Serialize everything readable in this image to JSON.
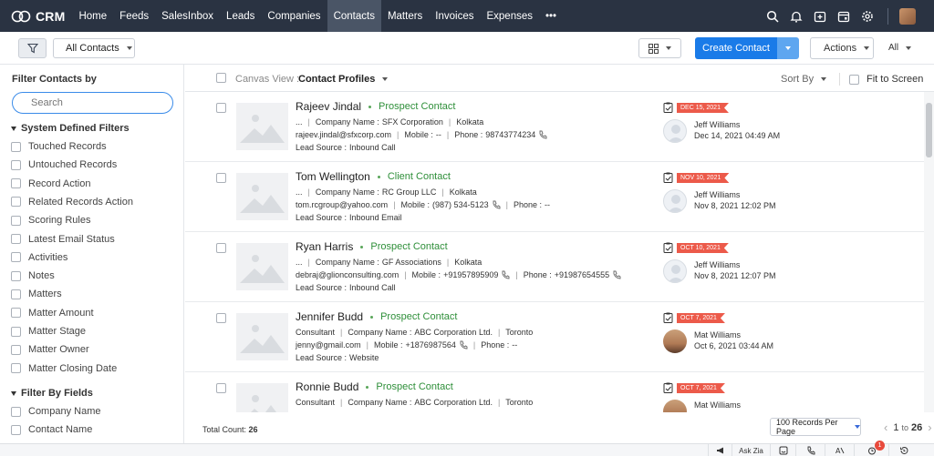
{
  "nav": {
    "brand": "CRM",
    "items": [
      "Home",
      "Feeds",
      "SalesInbox",
      "Leads",
      "Companies",
      "Contacts",
      "Matters",
      "Invoices",
      "Expenses",
      "•••"
    ],
    "active_index": 5,
    "icons": [
      "search-icon",
      "bell-icon",
      "calendar-add-icon",
      "calendar-icon",
      "gear-icon"
    ]
  },
  "toolbar": {
    "view_label": "All Contacts",
    "create_label": "Create Contact",
    "actions_label": "Actions",
    "all_label": "All"
  },
  "sidebar": {
    "title": "Filter Contacts by",
    "search_placeholder": "Search",
    "section1": "System Defined Filters",
    "system_filters": [
      "Touched Records",
      "Untouched Records",
      "Record Action",
      "Related Records Action",
      "Scoring Rules",
      "Latest Email Status",
      "Activities",
      "Notes",
      "Matters",
      "Matter Amount",
      "Matter Stage",
      "Matter Owner",
      "Matter Closing Date"
    ],
    "section2": "Filter By Fields",
    "field_filters": [
      "Company Name",
      "Contact Name"
    ]
  },
  "main": {
    "canvas_label": "Canvas View :",
    "canvas_value": "Contact Profiles",
    "sort_label": "Sort By",
    "fit_label": "Fit to Screen",
    "total_count_label": "Total Count:",
    "total_count": "26",
    "per_page": "100 Records Per Page",
    "pager_from": "1",
    "pager_to_label": "to",
    "pager_to": "26"
  },
  "records": [
    {
      "name": "Rajeev Jindal",
      "type": "Prospect Contact",
      "title": "...",
      "company_label": "Company Name :",
      "company": "SFX Corporation",
      "city": "Kolkata",
      "email": "rajeev.jindal@sfxcorp.com",
      "mobile_label": "Mobile :",
      "mobile": "--",
      "phone_label": "Phone :",
      "phone": "98743774234",
      "lead_label": "Lead Source :",
      "lead": "Inbound Call",
      "date": "DEC 15, 2021",
      "owner": "Jeff Williams",
      "owner_date": "Dec 14, 2021 04:49 AM"
    },
    {
      "name": "Tom Wellington",
      "type": "Client Contact",
      "title": "...",
      "company_label": "Company Name :",
      "company": "RC Group LLC",
      "city": "Kolkata",
      "email": "tom.rcgroup@yahoo.com",
      "mobile_label": "Mobile :",
      "mobile": "(987) 534-5123",
      "phone_label": "Phone :",
      "phone": "--",
      "lead_label": "Lead Source :",
      "lead": "Inbound Email",
      "date": "NOV 10, 2021",
      "owner": "Jeff Williams",
      "owner_date": "Nov 8, 2021 12:02 PM"
    },
    {
      "name": "Ryan Harris",
      "type": "Prospect Contact",
      "title": "...",
      "company_label": "Company Name :",
      "company": "GF Associations",
      "city": "Kolkata",
      "email": "debraj@glionconsulting.com",
      "mobile_label": "Mobile :",
      "mobile": "+91957895909",
      "phone_label": "Phone :",
      "phone": "+91987654555",
      "lead_label": "Lead Source :",
      "lead": "Inbound Call",
      "date": "OCT 10, 2021",
      "owner": "Jeff Williams",
      "owner_date": "Nov 8, 2021 12:07 PM"
    },
    {
      "name": "Jennifer Budd",
      "type": "Prospect Contact",
      "title": "Consultant",
      "company_label": "Company Name :",
      "company": "ABC Corporation Ltd.",
      "city": "Toronto",
      "email": "jenny@gmail.com",
      "mobile_label": "Mobile :",
      "mobile": "+1876987564",
      "phone_label": "Phone :",
      "phone": "--",
      "lead_label": "Lead Source :",
      "lead": "Website",
      "date": "OCT 7, 2021",
      "owner": "Mat Williams",
      "owner_date": "Oct 6, 2021 03:44 AM"
    },
    {
      "name": "Ronnie Budd",
      "type": "Prospect Contact",
      "title": "Consultant",
      "company_label": "Company Name :",
      "company": "ABC Corporation Ltd.",
      "city": "Toronto",
      "date": "OCT 7, 2021",
      "owner": "Mat Williams"
    }
  ],
  "bottombar": {
    "ask_zia": "Ask Zia",
    "notification_count": "1"
  },
  "colors": {
    "nav_bg": "#2a3342",
    "primary": "#1a7be8",
    "badge": "#ec5a4a",
    "contact_type": "#2f8f3a"
  }
}
